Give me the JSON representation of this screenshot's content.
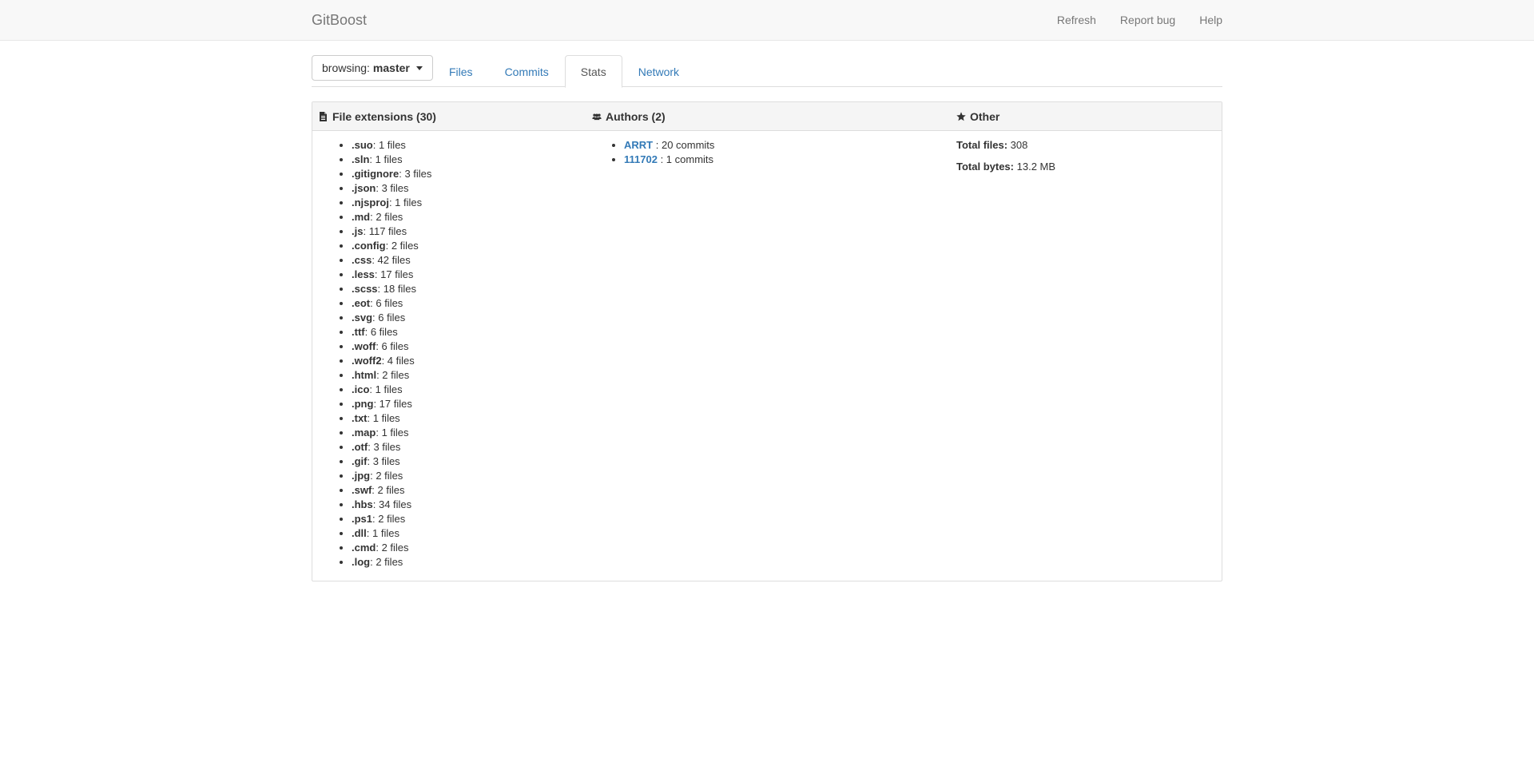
{
  "navbar": {
    "brand": "GitBoost",
    "links": [
      "Refresh",
      "Report bug",
      "Help"
    ]
  },
  "branch": {
    "prefix": "browsing:",
    "name": "master"
  },
  "tabs": [
    {
      "label": "Files",
      "active": false
    },
    {
      "label": "Commits",
      "active": false
    },
    {
      "label": "Stats",
      "active": true
    },
    {
      "label": "Network",
      "active": false
    }
  ],
  "stats": {
    "extensions": {
      "title": "File extensions (30)",
      "icon": "file-icon",
      "items": [
        {
          "ext": ".suo",
          "count": ": 1 files"
        },
        {
          "ext": ".sln",
          "count": ": 1 files"
        },
        {
          "ext": ".gitignore",
          "count": ": 3 files"
        },
        {
          "ext": ".json",
          "count": ": 3 files"
        },
        {
          "ext": ".njsproj",
          "count": ": 1 files"
        },
        {
          "ext": ".md",
          "count": ": 2 files"
        },
        {
          "ext": ".js",
          "count": ": 117 files"
        },
        {
          "ext": ".config",
          "count": ": 2 files"
        },
        {
          "ext": ".css",
          "count": ": 42 files"
        },
        {
          "ext": ".less",
          "count": ": 17 files"
        },
        {
          "ext": ".scss",
          "count": ": 18 files"
        },
        {
          "ext": ".eot",
          "count": ": 6 files"
        },
        {
          "ext": ".svg",
          "count": ": 6 files"
        },
        {
          "ext": ".ttf",
          "count": ": 6 files"
        },
        {
          "ext": ".woff",
          "count": ": 6 files"
        },
        {
          "ext": ".woff2",
          "count": ": 4 files"
        },
        {
          "ext": ".html",
          "count": ": 2 files"
        },
        {
          "ext": ".ico",
          "count": ": 1 files"
        },
        {
          "ext": ".png",
          "count": ": 17 files"
        },
        {
          "ext": ".txt",
          "count": ": 1 files"
        },
        {
          "ext": ".map",
          "count": ": 1 files"
        },
        {
          "ext": ".otf",
          "count": ": 3 files"
        },
        {
          "ext": ".gif",
          "count": ": 3 files"
        },
        {
          "ext": ".jpg",
          "count": ": 2 files"
        },
        {
          "ext": ".swf",
          "count": ": 2 files"
        },
        {
          "ext": ".hbs",
          "count": ": 34 files"
        },
        {
          "ext": ".ps1",
          "count": ": 2 files"
        },
        {
          "ext": ".dll",
          "count": ": 1 files"
        },
        {
          "ext": ".cmd",
          "count": ": 2 files"
        },
        {
          "ext": ".log",
          "count": ": 2 files"
        }
      ]
    },
    "authors": {
      "title": "Authors (2)",
      "icon": "users-icon",
      "items": [
        {
          "name": "ARRT",
          "commits": ": 20 commits"
        },
        {
          "name": "111702",
          "commits": ": 1 commits"
        }
      ]
    },
    "other": {
      "title": "Other",
      "icon": "star-icon",
      "total_files_label": "Total files:",
      "total_files": "308",
      "total_bytes_label": "Total bytes:",
      "total_bytes": "13.2 MB"
    }
  }
}
